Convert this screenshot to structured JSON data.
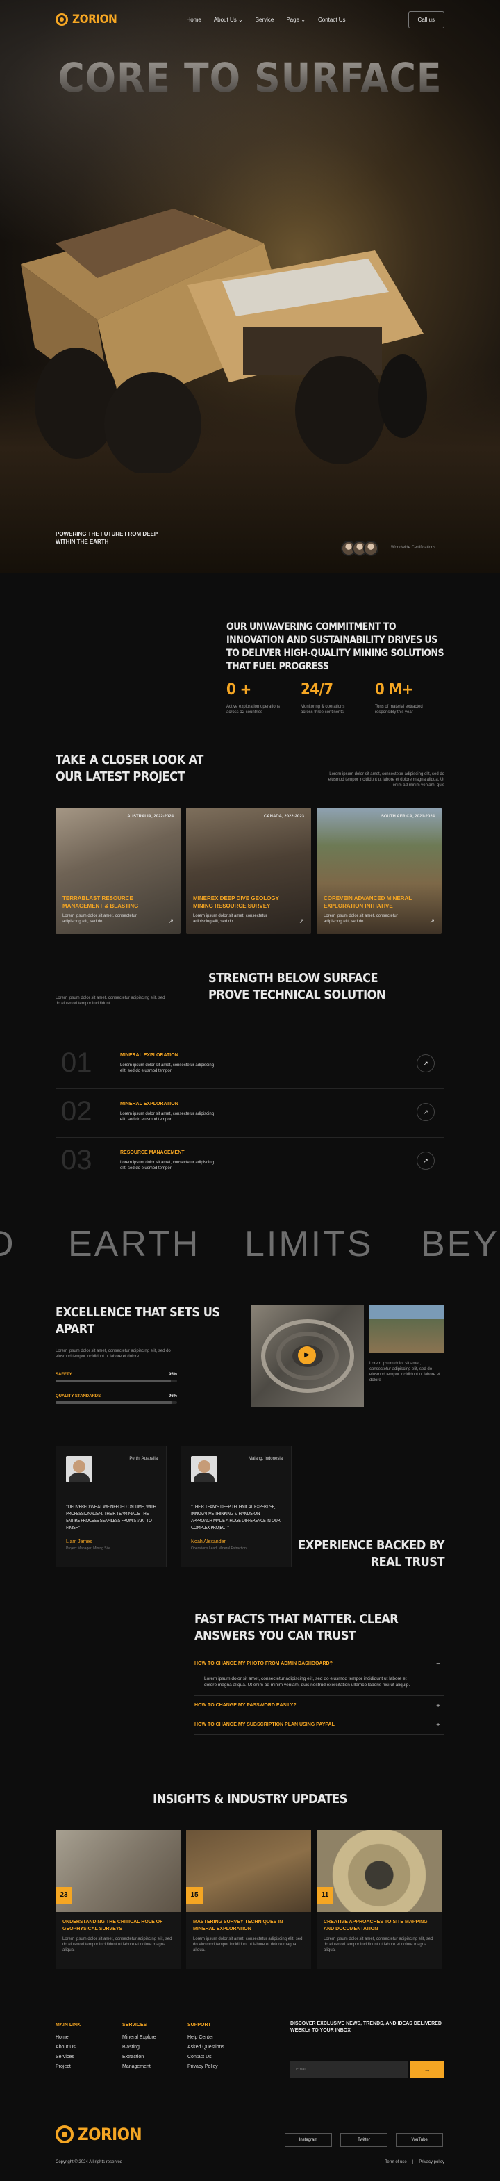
{
  "brand": {
    "name": "ZORION",
    "accent": "#f5a623"
  },
  "nav": {
    "items": [
      "Home",
      "About Us",
      "Service",
      "Page",
      "Contact Us"
    ],
    "cta": "Call us"
  },
  "hero": {
    "headline": "CORE TO SURFACE",
    "tagline": "POWERING THE FUTURE FROM DEEP WITHIN THE EARTH",
    "avatars_label": "Worldwide Certifications"
  },
  "commitment": {
    "text": "OUR UNWAVERING COMMITMENT TO INNOVATION AND SUSTAINABILITY DRIVES US TO DELIVER HIGH-QUALITY MINING SOLUTIONS THAT FUEL PROGRESS",
    "stats": [
      {
        "value": "0 +",
        "label": "Active exploration operations across 12 countries"
      },
      {
        "value": "24/7",
        "label": "Monitoring & operations across three continents"
      },
      {
        "value": "0 M+",
        "label": "Tons of material extracted responsibly this year"
      }
    ]
  },
  "projects": {
    "title": "TAKE A CLOSER LOOK AT OUR LATEST PROJECT",
    "description": "Lorem ipsum dolor sit amet, consectetur adipiscing elit, sed do eiusmod tempor incididunt ut labore et dolore magna aliqua. Ut enim ad minim veniam, quis",
    "cards": [
      {
        "location": "AUSTRALIA, 2022-2024",
        "title": "TERRABLAST RESOURCE MANAGEMENT & BLASTING",
        "desc": "Lorem ipsum dolor sit amet, consectetur adipiscing elit, sed do",
        "arrow": "↗"
      },
      {
        "location": "CANADA, 2022-2023",
        "title": "MINEREX DEEP DIVE GEOLOGY MINING RESOURCE SURVEY",
        "desc": "Lorem ipsum dolor sit amet, consectetur adipiscing elit, sed do",
        "arrow": "↗"
      },
      {
        "location": "SOUTH AFRICA, 2021-2024",
        "title": "COREVEIN ADVANCED MINERAL EXPLORATION INITIATIVE",
        "desc": "Lorem ipsum dolor sit amet, consectetur adipiscing elit, sed do",
        "arrow": "↗"
      }
    ]
  },
  "strength": {
    "title": "STRENGTH BELOW SURFACE PROVE TECHNICAL SOLUTION",
    "side": "Lorem ipsum dolor sit amet, consectetur adipiscing elit, sed do eiusmod tempor incididunt",
    "rows": [
      {
        "num": "01",
        "title": "MINERAL EXPLORATION",
        "desc": "Lorem ipsum dolor sit amet, consectetur adipiscing elit, sed do eiusmod tempor",
        "arrow": "↗"
      },
      {
        "num": "02",
        "title": "MINERAL EXPLORATION",
        "desc": "Lorem ipsum dolor sit amet, consectetur adipiscing elit, sed do eiusmod tempor",
        "arrow": "↗"
      },
      {
        "num": "03",
        "title": "RESOURCE MANAGEMENT",
        "desc": "Lorem ipsum dolor sit amet, consectetur adipiscing elit, sed do eiusmod tempor",
        "arrow": "↗"
      }
    ]
  },
  "marquee": {
    "words": [
      "D",
      "EARTH",
      "LIMITS",
      "BEY"
    ]
  },
  "excellence": {
    "title": "EXCELLENCE THAT SETS US APART",
    "desc": "Lorem ipsum dolor sit amet, consectetur adipiscing elit, sed do eiusmod tempor incididunt ut labore et dolore",
    "bars": [
      {
        "label": "SAFETY",
        "value": "95%",
        "fraction": 0.95
      },
      {
        "label": "QUALITY STANDARDS",
        "value": "96%",
        "fraction": 0.96
      }
    ],
    "play": "▶",
    "side_desc": "Lorem ipsum dolor sit amet, consectetur adipiscing elit, sed do eiusmod tempor incididunt ut labore et dolore"
  },
  "testimonials": [
    {
      "place": "Perth, Australia",
      "quote": "\"DELIVERED WHAT WE NEEDED ON TIME, WITH PROFESSIONALISM. THEIR TEAM MADE THE ENTIRE PROCESS SEAMLESS FROM START TO FINISH\"",
      "name": "Liam James",
      "role": "Project Manager, Mining Site"
    },
    {
      "place": "Malang, Indonesia",
      "quote": "\"THEIR TEAM'S DEEP TECHNICAL EXPERTISE, INNOVATIVE THINKING & HANDS-ON APPROACH MADE A HUGE DIFFERENCE IN OUR COMPLEX PROJECT\"",
      "name": "Noah Alexander",
      "role": "Operations Lead, Mineral Extraction"
    }
  ],
  "experience": {
    "title": "EXPERIENCE BACKED BY REAL TRUST"
  },
  "faq": {
    "title": "FAST FACTS THAT MATTER. CLEAR ANSWERS YOU CAN TRUST",
    "items": [
      {
        "q": "HOW TO CHANGE MY PHOTO FROM ADMIN DASHBOARD?",
        "sign": "−",
        "a": "Lorem ipsum dolor sit amet, consectetur adipiscing elit, sed do eiusmod tempor incididunt ut labore et dolore magna aliqua. Ut enim ad minim veniam, quis nostrud exercitation ullamco laboris nisi ut aliquip."
      },
      {
        "q": "HOW TO CHANGE MY PASSWORD EASILY?",
        "sign": "+",
        "a": ""
      },
      {
        "q": "HOW TO CHANGE MY SUBSCRIPTION PLAN USING PAYPAL",
        "sign": "+",
        "a": ""
      }
    ]
  },
  "insights": {
    "title": "INSIGHTS & INDUSTRY UPDATES",
    "cards": [
      {
        "date": "23",
        "title": "UNDERSTANDING THE CRITICAL ROLE OF GEOPHYSICAL SURVEYS",
        "desc": "Lorem ipsum dolor sit amet, consectetur adipiscing elit, sed do eiusmod tempor incididunt ut labore et dolore magna aliqua."
      },
      {
        "date": "15",
        "title": "MASTERING SURVEY TECHNIQUES IN MINERAL EXPLORATION",
        "desc": "Lorem ipsum dolor sit amet, consectetur adipiscing elit, sed do eiusmod tempor incididunt ut labore et dolore magna aliqua."
      },
      {
        "date": "11",
        "title": "CREATIVE APPROACHES TO SITE MAPPING AND DOCUMENTATION",
        "desc": "Lorem ipsum dolor sit amet, consectetur adipiscing elit, sed do eiusmod tempor incididunt ut labore et dolore magna aliqua."
      }
    ]
  },
  "footer": {
    "cols": [
      {
        "h": "MAIN LINK",
        "links": [
          "Home",
          "About Us",
          "Services",
          "Project"
        ]
      },
      {
        "h": "SERVICES",
        "links": [
          "Mineral Explore",
          "Blasting",
          "Extraction",
          "Management"
        ]
      },
      {
        "h": "SUPPORT",
        "links": [
          "Help Center",
          "Asked Questions",
          "Contact Us",
          "Privacy Policy"
        ]
      }
    ],
    "newsletter": "DISCOVER EXCLUSIVE NEWS, TRENDS, AND IDEAS DELIVERED WEEKLY TO YOUR INBOX",
    "email_placeholder": "Email",
    "send": "→",
    "social": [
      "Instagram",
      "Twitter",
      "YouTube"
    ],
    "copyright": "Copyright © 2024 All rights reserved",
    "legal": [
      "Term of use",
      "Privacy policy"
    ]
  }
}
